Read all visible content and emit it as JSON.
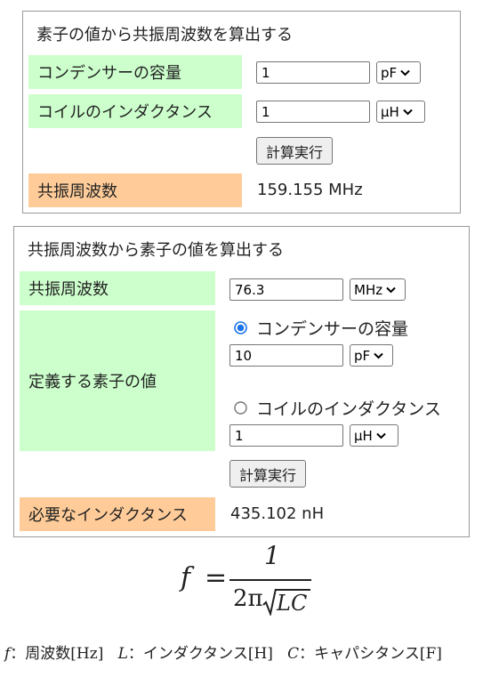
{
  "panel1": {
    "title": "素子の値から共振周波数を算出する",
    "capacitance": {
      "label": "コンデンサーの容量",
      "value": "1",
      "unit": "pF"
    },
    "inductance": {
      "label": "コイルのインダクタンス",
      "value": "1",
      "unit": "μH"
    },
    "calc_button": "計算実行",
    "result_label": "共振周波数",
    "result_value": "159.155 MHz"
  },
  "panel2": {
    "title": "共振周波数から素子の値を算出する",
    "frequency": {
      "label": "共振周波数",
      "value": "76.3",
      "unit": "MHz"
    },
    "defined_label": "定義する素子の値",
    "option_capacitor": {
      "label": "コンデンサーの容量",
      "selected": true,
      "value": "10",
      "unit": "pF"
    },
    "option_inductor": {
      "label": "コイルのインダクタンス",
      "selected": false,
      "value": "1",
      "unit": "μH"
    },
    "calc_button": "計算実行",
    "result_label": "必要なインダクタンス",
    "result_value": "435.102 nH"
  },
  "formula": {
    "lhs": "f",
    "equals": "=",
    "numerator": "1",
    "denominator_prefix": "2π",
    "radicand": "LC"
  },
  "legend": {
    "f_symbol": "f",
    "f_text": "：周波数[Hz]",
    "l_symbol": "L",
    "l_text": "：インダクタンス[H]",
    "c_symbol": "C",
    "c_text": "：キャパシタンス[F]"
  },
  "colors": {
    "label_green": "#ccffcc",
    "label_orange": "#ffcc99",
    "radio_accent": "#1a73e8"
  },
  "icons": {
    "select_arrow": "chevron-down-icon"
  }
}
